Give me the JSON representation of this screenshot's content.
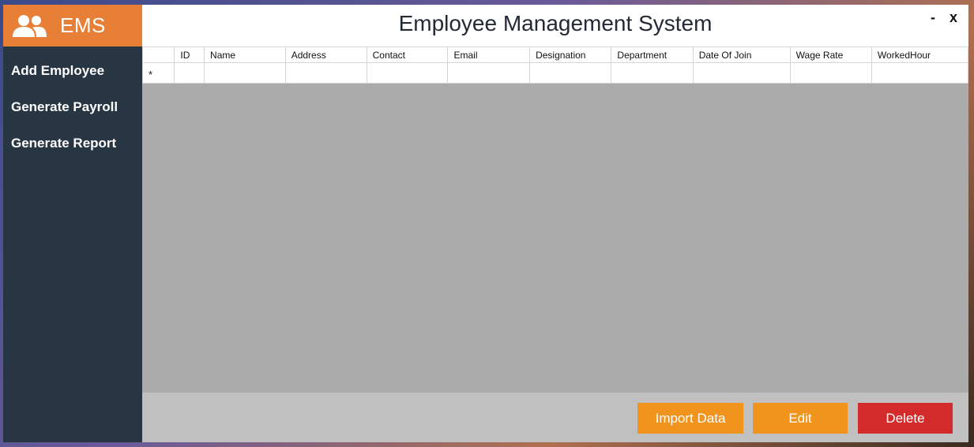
{
  "brand": {
    "name": "EMS",
    "icon": "users-icon",
    "color": "#e87f36"
  },
  "sidebar": {
    "items": [
      {
        "label": "Add Employee"
      },
      {
        "label": "Generate Payroll"
      },
      {
        "label": "Generate Report"
      }
    ]
  },
  "header": {
    "title": "Employee Management System",
    "minimize_label": "-",
    "close_label": "x"
  },
  "table": {
    "columns": [
      "ID",
      "Name",
      "Address",
      "Contact",
      "Email",
      "Designation",
      "Department",
      "Date Of Join",
      "Wage Rate",
      "WorkedHour"
    ],
    "new_row_marker": "*"
  },
  "footer": {
    "import_label": "Import Data",
    "edit_label": "Edit",
    "delete_label": "Delete"
  },
  "colors": {
    "sidebar": "#283644",
    "accent": "#f0941e",
    "danger": "#d32a2a",
    "grid_bg": "#ababab"
  }
}
